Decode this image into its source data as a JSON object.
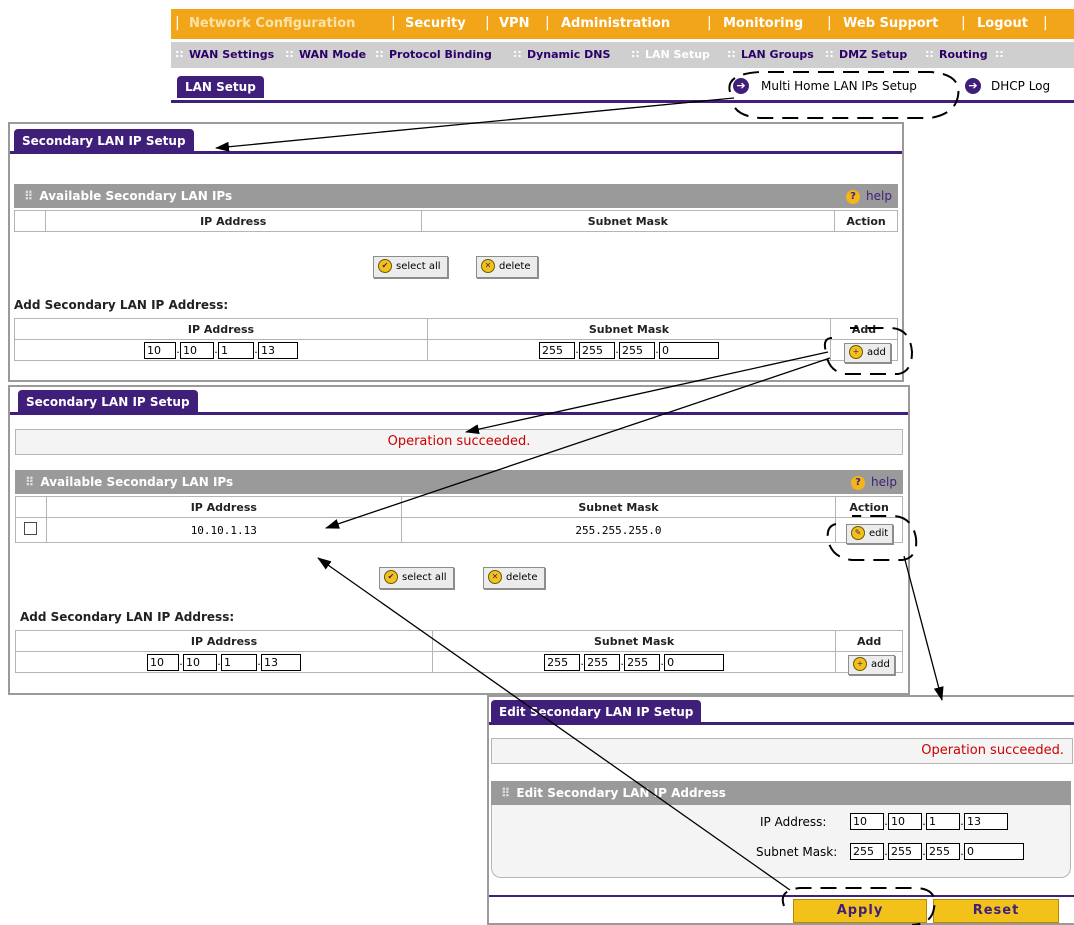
{
  "top_nav": {
    "items": [
      "Network Configuration",
      "Security",
      "VPN",
      "Administration",
      "Monitoring",
      "Web Support",
      "Logout"
    ]
  },
  "sub_nav": {
    "items": [
      "WAN Settings",
      "WAN Mode",
      "Protocol Binding",
      "Dynamic DNS",
      "LAN Setup",
      "LAN Groups",
      "DMZ Setup",
      "Routing"
    ]
  },
  "lan_tab": {
    "label": "LAN Setup",
    "links": [
      "Multi Home LAN IPs Setup",
      "DHCP Log"
    ]
  },
  "panel1": {
    "title": "Secondary LAN IP Setup",
    "available_header": "Available Secondary LAN IPs",
    "help": "help",
    "columns": [
      "IP Address",
      "Subnet Mask",
      "Action"
    ],
    "select_all": "select all",
    "delete": "delete",
    "add_heading": "Add Secondary LAN IP Address:",
    "add_columns": [
      "IP Address",
      "Subnet Mask",
      "Add"
    ],
    "ip": [
      "10",
      "10",
      "1",
      "13"
    ],
    "mask": [
      "255",
      "255",
      "255",
      "0"
    ],
    "add_btn": "add"
  },
  "panel2": {
    "title": "Secondary LAN IP Setup",
    "message": "Operation succeeded.",
    "available_header": "Available Secondary LAN IPs",
    "help": "help",
    "columns": [
      "IP Address",
      "Subnet Mask",
      "Action"
    ],
    "row": {
      "ip": "10.10.1.13",
      "mask": "255.255.255.0",
      "edit": "edit"
    },
    "select_all": "select all",
    "delete": "delete",
    "add_heading": "Add Secondary LAN IP Address:",
    "add_columns": [
      "IP Address",
      "Subnet Mask",
      "Add"
    ],
    "ip": [
      "10",
      "10",
      "1",
      "13"
    ],
    "mask": [
      "255",
      "255",
      "255",
      "0"
    ],
    "add_btn": "add"
  },
  "panel3": {
    "title": "Edit Secondary LAN IP Setup",
    "message": "Operation succeeded.",
    "section": "Edit Secondary LAN IP Address",
    "ip_label": "IP Address:",
    "mask_label": "Subnet Mask:",
    "ip": [
      "10",
      "10",
      "1",
      "13"
    ],
    "mask": [
      "255",
      "255",
      "255",
      "0"
    ],
    "apply": "Apply",
    "reset": "Reset"
  },
  "colors": {
    "nav_orange": "#f3a51a",
    "brand_purple": "#3f1f7a",
    "success_red": "#cc0000"
  }
}
